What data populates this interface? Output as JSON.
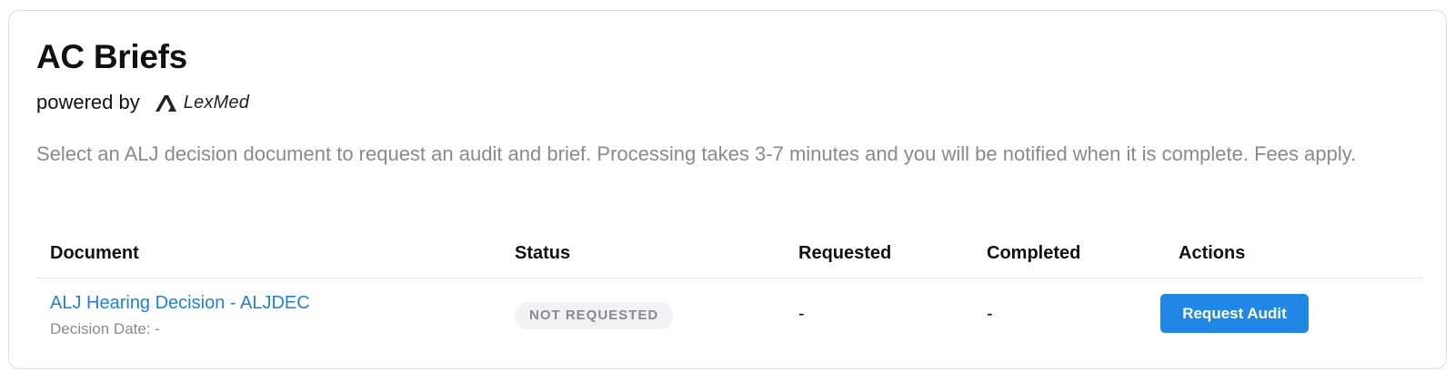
{
  "header": {
    "title": "AC Briefs",
    "powered_by": "powered by",
    "brand": {
      "name": "LexMed",
      "icon": "lexmed-logo-icon"
    }
  },
  "description": "Select an ALJ decision document to request an audit and brief. Processing takes 3-7 minutes and you will be notified when it is complete. Fees apply.",
  "table": {
    "columns": [
      "Document",
      "Status",
      "Requested",
      "Completed",
      "Actions"
    ],
    "rows": [
      {
        "document": "ALJ Hearing Decision - ALJDEC",
        "decision_date": "Decision Date: -",
        "status": "NOT REQUESTED",
        "requested": "-",
        "completed": "-",
        "action_label": "Request Audit"
      }
    ]
  },
  "colors": {
    "accent": "#2087e4",
    "link": "#1f82d6",
    "muted_text": "#8a8a8e",
    "badge_bg": "#f2f2f4",
    "border": "#dcdcdc"
  }
}
